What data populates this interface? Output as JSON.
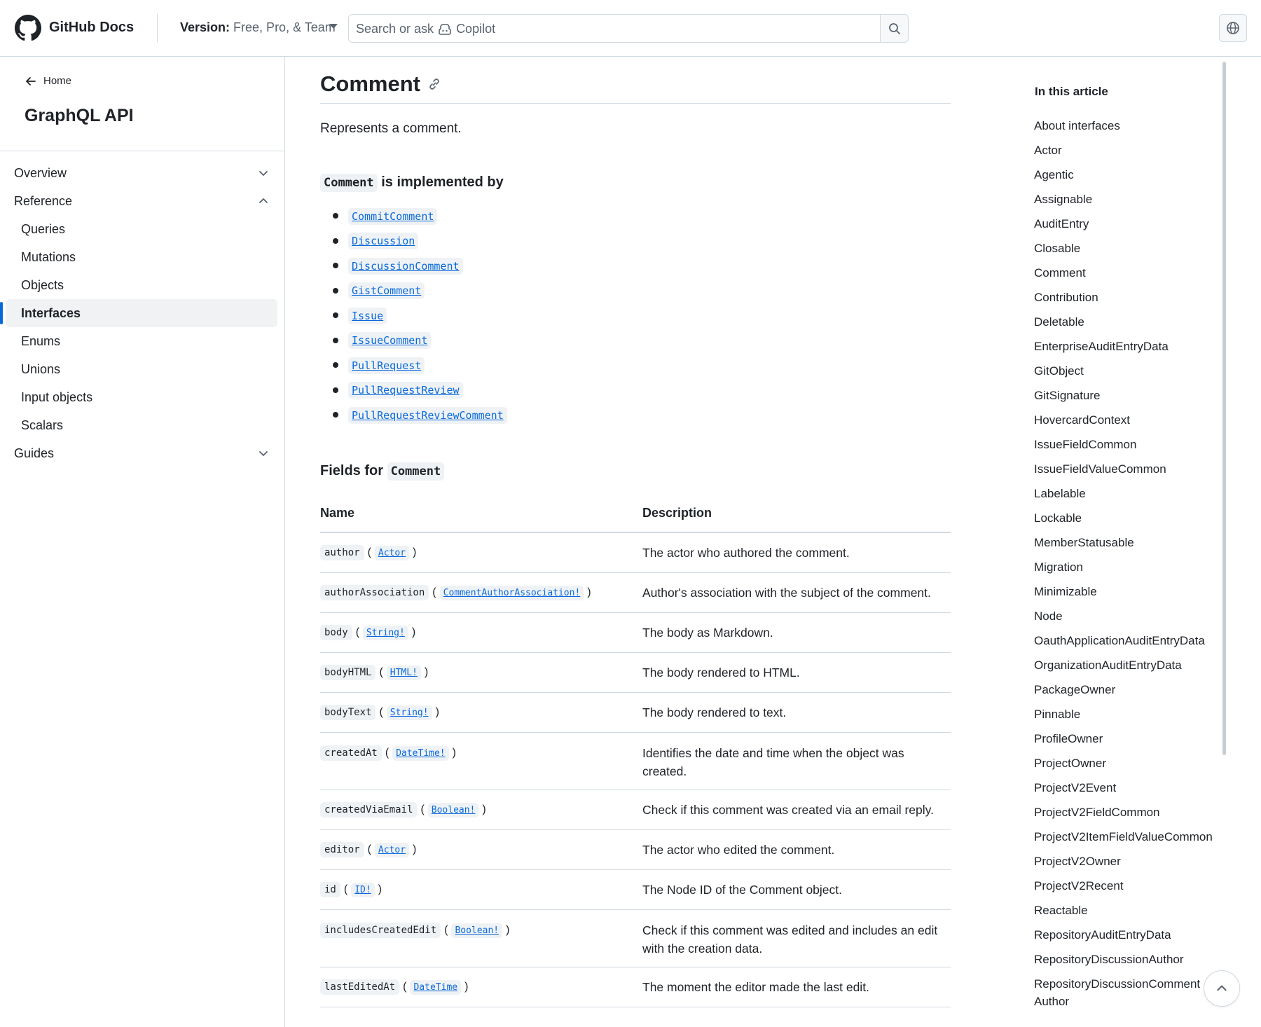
{
  "header": {
    "brand": "GitHub Docs",
    "version_label": "Version:",
    "version_value": "Free, Pro, & Team",
    "search_placeholder_prefix": "Search or ask",
    "search_placeholder_suffix": "Copilot"
  },
  "sidebar": {
    "home": "Home",
    "title": "GraphQL API",
    "nav": [
      {
        "label": "Overview",
        "state": "collapsed"
      },
      {
        "label": "Reference",
        "state": "expanded"
      },
      {
        "label": "Queries"
      },
      {
        "label": "Mutations"
      },
      {
        "label": "Objects"
      },
      {
        "label": "Interfaces",
        "active": true
      },
      {
        "label": "Enums"
      },
      {
        "label": "Unions"
      },
      {
        "label": "Input objects"
      },
      {
        "label": "Scalars"
      },
      {
        "label": "Guides",
        "state": "collapsed"
      }
    ]
  },
  "main": {
    "title": "Comment",
    "intro": "Represents a comment.",
    "impl_code": "Comment",
    "impl_text": "is implemented by",
    "implementers": [
      "CommitComment",
      "Discussion",
      "DiscussionComment",
      "GistComment",
      "Issue",
      "IssueComment",
      "PullRequest",
      "PullRequestReview",
      "PullRequestReviewComment"
    ],
    "fields_text": "Fields for",
    "fields_code": "Comment",
    "table_headers": {
      "name": "Name",
      "description": "Description"
    },
    "fields": [
      {
        "name": "author",
        "type": "Actor",
        "description": "The actor who authored the comment."
      },
      {
        "name": "authorAssociation",
        "type": "CommentAuthorAssociation!",
        "description": "Author's association with the subject of the comment."
      },
      {
        "name": "body",
        "type": "String!",
        "description": "The body as Markdown."
      },
      {
        "name": "bodyHTML",
        "type": "HTML!",
        "description": "The body rendered to HTML."
      },
      {
        "name": "bodyText",
        "type": "String!",
        "description": "The body rendered to text."
      },
      {
        "name": "createdAt",
        "type": "DateTime!",
        "description": "Identifies the date and time when the object was created."
      },
      {
        "name": "createdViaEmail",
        "type": "Boolean!",
        "description": "Check if this comment was created via an email reply."
      },
      {
        "name": "editor",
        "type": "Actor",
        "description": "The actor who edited the comment."
      },
      {
        "name": "id",
        "type": "ID!",
        "description": "The Node ID of the Comment object."
      },
      {
        "name": "includesCreatedEdit",
        "type": "Boolean!",
        "description": "Check if this comment was edited and includes an edit with the creation data."
      },
      {
        "name": "lastEditedAt",
        "type": "DateTime",
        "description": "The moment the editor made the last edit."
      }
    ]
  },
  "toc": {
    "title": "In this article",
    "items": [
      "About interfaces",
      "Actor",
      "Agentic",
      "Assignable",
      "AuditEntry",
      "Closable",
      "Comment",
      "Contribution",
      "Deletable",
      "EnterpriseAuditEntryData",
      "GitObject",
      "GitSignature",
      "HovercardContext",
      "IssueFieldCommon",
      "IssueFieldValueCommon",
      "Labelable",
      "Lockable",
      "MemberStatusable",
      "Migration",
      "Minimizable",
      "Node",
      "OauthApplicationAuditEntryData",
      "OrganizationAuditEntryData",
      "PackageOwner",
      "Pinnable",
      "ProfileOwner",
      "ProjectOwner",
      "ProjectV2Event",
      "ProjectV2FieldCommon",
      "ProjectV2ItemFieldValueCommon",
      "ProjectV2Owner",
      "ProjectV2Recent",
      "Reactable",
      "RepositoryAuditEntryData",
      "RepositoryDiscussionAuthor",
      "RepositoryDiscussionCommentAuthor"
    ]
  },
  "icons": {
    "logo": "github-mark-icon",
    "caret": "caret-down-icon",
    "search": "search-icon",
    "copilot": "copilot-icon",
    "globe": "globe-icon",
    "back": "arrow-left-icon",
    "link": "link-icon",
    "scroll_top": "chevron-up-icon"
  },
  "colors": {
    "link": "#0969da",
    "active_bar": "#0969da",
    "border": "#d1d9e0",
    "text": "#1f2328",
    "muted": "#59636e"
  }
}
